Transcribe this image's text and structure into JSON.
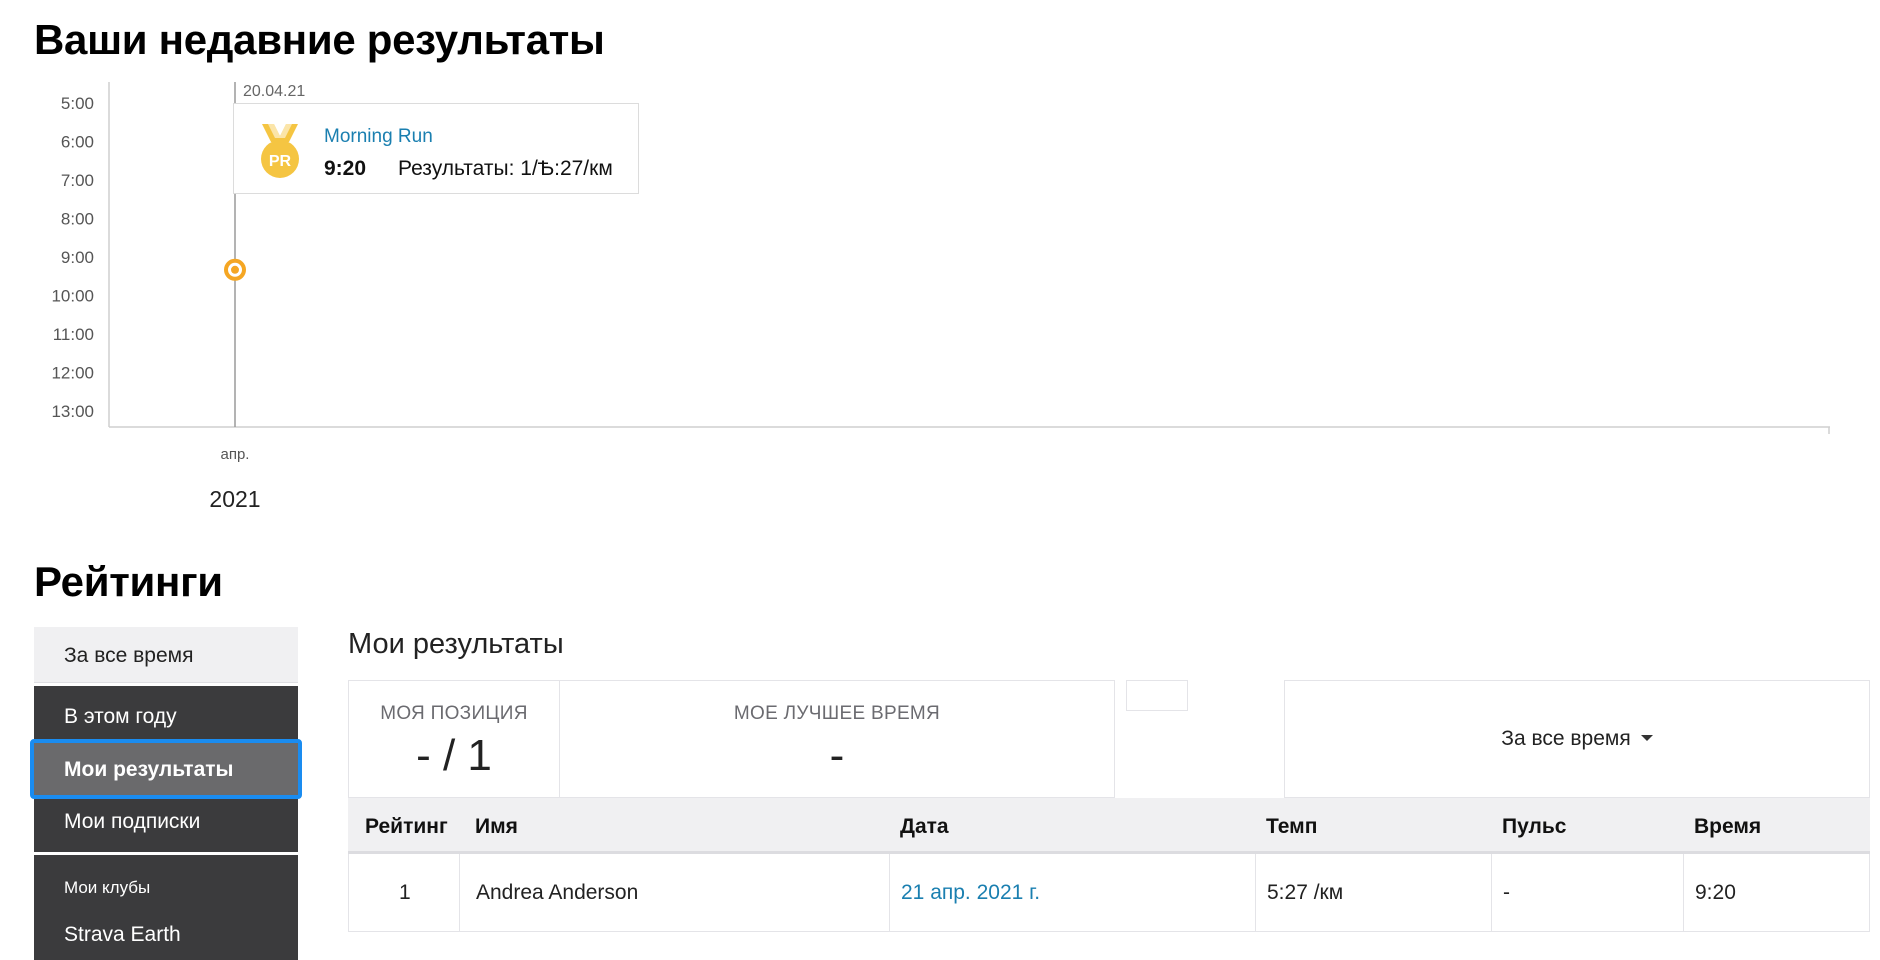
{
  "recent_title": "Ваши недавние результаты",
  "ratings_title": "Рейтинги",
  "chart_data": {
    "type": "scatter",
    "y_ticks": [
      "5:00",
      "6:00",
      "7:00",
      "8:00",
      "9:00",
      "10:00",
      "11:00",
      "12:00",
      "13:00"
    ],
    "y_axis": "time (min:sec), inverted",
    "x_ticks": [
      "апр."
    ],
    "x_year": "2021",
    "points": [
      {
        "x": "20.04.21",
        "y": "9:20",
        "highlight": true
      }
    ],
    "tooltip": {
      "date": "20.04.21",
      "name": "Morning Run",
      "time": "9:20",
      "result": "Результаты: 1/Ѣ:27/км"
    },
    "colors": {
      "point": "#f5a623",
      "grid": "#cccccc"
    }
  },
  "sidebar": {
    "all_time": "За все время",
    "this_year": "В этом году",
    "my_results": "Мои результаты",
    "my_subscriptions": "Мои подписки",
    "my_clubs": "Мои клубы",
    "club_item": "Strava Earth"
  },
  "main": {
    "title": "Мои результаты",
    "my_position_label": "МОЯ ПОЗИЦИЯ",
    "my_position_value": "- / 1",
    "best_time_label": "МОЕ ЛУЧШЕЕ ВРЕМЯ",
    "best_time_value": "-",
    "filter": "За все время"
  },
  "table": {
    "headers": [
      "Рейтинг",
      "Имя",
      "Дата",
      "Темп",
      "Пульс",
      "Время"
    ],
    "rows": [
      {
        "rank": "1",
        "name": "Andrea Anderson",
        "date": "21 апр. 2021 г.",
        "pace": "5:27 /км",
        "hr": "-",
        "time": "9:20"
      }
    ]
  },
  "colors": {
    "accent": "#f5a623",
    "link": "#1a7fb0",
    "selection": "#1a8cf0",
    "sidebar": "#3b3b3d"
  }
}
